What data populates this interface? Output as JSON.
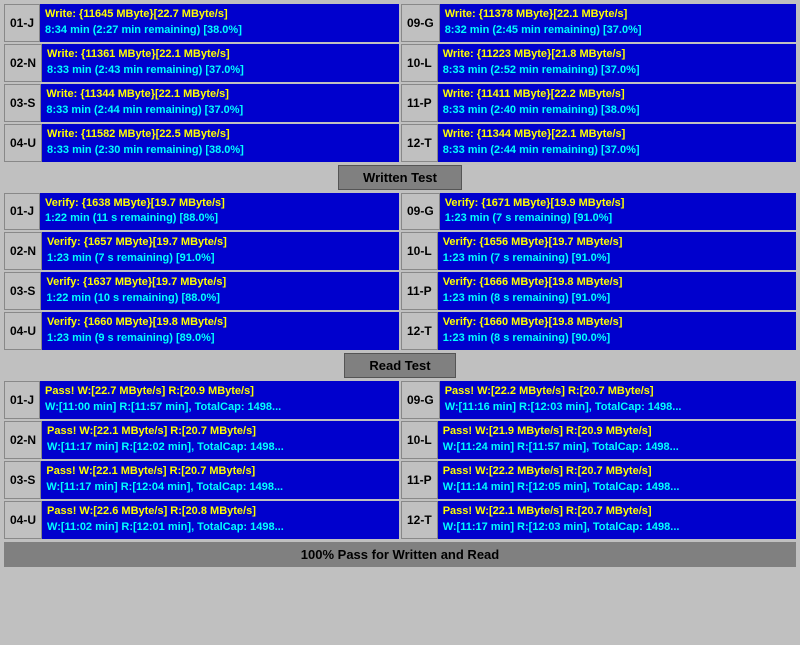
{
  "sections": {
    "write": {
      "label": "Written Test",
      "rows": [
        {
          "left": {
            "id": "01-J",
            "line1": "Write: {11645 MByte}[22.7 MByte/s]",
            "line2": "8:34 min (2:27 min remaining)  [38.0%]"
          },
          "right": {
            "id": "09-G",
            "line1": "Write: {11378 MByte}[22.1 MByte/s]",
            "line2": "8:32 min (2:45 min remaining)  [37.0%]"
          }
        },
        {
          "left": {
            "id": "02-N",
            "line1": "Write: {11361 MByte}[22.1 MByte/s]",
            "line2": "8:33 min (2:43 min remaining)  [37.0%]"
          },
          "right": {
            "id": "10-L",
            "line1": "Write: {11223 MByte}[21.8 MByte/s]",
            "line2": "8:33 min (2:52 min remaining)  [37.0%]"
          }
        },
        {
          "left": {
            "id": "03-S",
            "line1": "Write: {11344 MByte}[22.1 MByte/s]",
            "line2": "8:33 min (2:44 min remaining)  [37.0%]"
          },
          "right": {
            "id": "11-P",
            "line1": "Write: {11411 MByte}[22.2 MByte/s]",
            "line2": "8:33 min (2:40 min remaining)  [38.0%]"
          }
        },
        {
          "left": {
            "id": "04-U",
            "line1": "Write: {11582 MByte}[22.5 MByte/s]",
            "line2": "8:33 min (2:30 min remaining)  [38.0%]"
          },
          "right": {
            "id": "12-T",
            "line1": "Write: {11344 MByte}[22.1 MByte/s]",
            "line2": "8:33 min (2:44 min remaining)  [37.0%]"
          }
        }
      ]
    },
    "verify": {
      "label": "Written Test",
      "rows": [
        {
          "left": {
            "id": "01-J",
            "line1": "Verify: {1638 MByte}[19.7 MByte/s]",
            "line2": "1:22 min (11 s remaining)   [88.0%]"
          },
          "right": {
            "id": "09-G",
            "line1": "Verify: {1671 MByte}[19.9 MByte/s]",
            "line2": "1:23 min (7 s remaining)   [91.0%]"
          }
        },
        {
          "left": {
            "id": "02-N",
            "line1": "Verify: {1657 MByte}[19.7 MByte/s]",
            "line2": "1:23 min (7 s remaining)   [91.0%]"
          },
          "right": {
            "id": "10-L",
            "line1": "Verify: {1656 MByte}[19.7 MByte/s]",
            "line2": "1:23 min (7 s remaining)   [91.0%]"
          }
        },
        {
          "left": {
            "id": "03-S",
            "line1": "Verify: {1637 MByte}[19.7 MByte/s]",
            "line2": "1:22 min (10 s remaining)   [88.0%]"
          },
          "right": {
            "id": "11-P",
            "line1": "Verify: {1666 MByte}[19.8 MByte/s]",
            "line2": "1:23 min (8 s remaining)   [91.0%]"
          }
        },
        {
          "left": {
            "id": "04-U",
            "line1": "Verify: {1660 MByte}[19.8 MByte/s]",
            "line2": "1:23 min (9 s remaining)   [89.0%]"
          },
          "right": {
            "id": "12-T",
            "line1": "Verify: {1660 MByte}[19.8 MByte/s]",
            "line2": "1:23 min (8 s remaining)   [90.0%]"
          }
        }
      ]
    },
    "read": {
      "label": "Read Test",
      "rows": [
        {
          "left": {
            "id": "01-J",
            "line1": "Pass! W:[22.7 MByte/s] R:[20.9 MByte/s]",
            "line2": "W:[11:00 min] R:[11:57 min], TotalCap: 1498..."
          },
          "right": {
            "id": "09-G",
            "line1": "Pass! W:[22.2 MByte/s] R:[20.7 MByte/s]",
            "line2": "W:[11:16 min] R:[12:03 min], TotalCap: 1498..."
          }
        },
        {
          "left": {
            "id": "02-N",
            "line1": "Pass! W:[22.1 MByte/s] R:[20.7 MByte/s]",
            "line2": "W:[11:17 min] R:[12:02 min], TotalCap: 1498..."
          },
          "right": {
            "id": "10-L",
            "line1": "Pass! W:[21.9 MByte/s] R:[20.9 MByte/s]",
            "line2": "W:[11:24 min] R:[11:57 min], TotalCap: 1498..."
          }
        },
        {
          "left": {
            "id": "03-S",
            "line1": "Pass! W:[22.1 MByte/s] R:[20.7 MByte/s]",
            "line2": "W:[11:17 min] R:[12:04 min], TotalCap: 1498..."
          },
          "right": {
            "id": "11-P",
            "line1": "Pass! W:[22.2 MByte/s] R:[20.7 MByte/s]",
            "line2": "W:[11:14 min] R:[12:05 min], TotalCap: 1498..."
          }
        },
        {
          "left": {
            "id": "04-U",
            "line1": "Pass! W:[22.6 MByte/s] R:[20.8 MByte/s]",
            "line2": "W:[11:02 min] R:[12:01 min], TotalCap: 1498..."
          },
          "right": {
            "id": "12-T",
            "line1": "Pass! W:[22.1 MByte/s] R:[20.7 MByte/s]",
            "line2": "W:[11:17 min] R:[12:03 min], TotalCap: 1498..."
          }
        }
      ]
    }
  },
  "labels": {
    "written_test": "Written Test",
    "read_test": "Read Test",
    "bottom_status": "100% Pass for Written and Read"
  }
}
